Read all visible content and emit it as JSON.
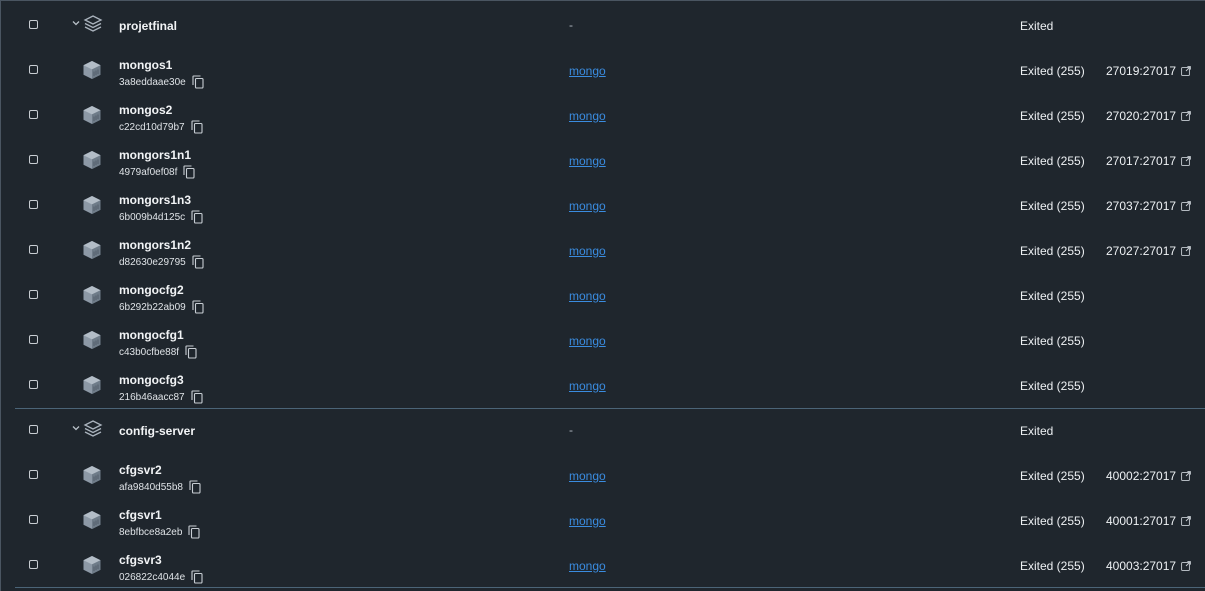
{
  "groups": [
    {
      "name": "projetfinal",
      "image": "-",
      "status": "Exited",
      "containers": [
        {
          "name": "mongos1",
          "id": "3a8eddaae30e",
          "image": "mongo",
          "status": "Exited (255)",
          "port": "27019:27017"
        },
        {
          "name": "mongos2",
          "id": "c22cd10d79b7",
          "image": "mongo",
          "status": "Exited (255)",
          "port": "27020:27017"
        },
        {
          "name": "mongors1n1",
          "id": "4979af0ef08f",
          "image": "mongo",
          "status": "Exited (255)",
          "port": "27017:27017"
        },
        {
          "name": "mongors1n3",
          "id": "6b009b4d125c",
          "image": "mongo",
          "status": "Exited (255)",
          "port": "27037:27017"
        },
        {
          "name": "mongors1n2",
          "id": "d82630e29795",
          "image": "mongo",
          "status": "Exited (255)",
          "port": "27027:27017"
        },
        {
          "name": "mongocfg2",
          "id": "6b292b22ab09",
          "image": "mongo",
          "status": "Exited (255)",
          "port": ""
        },
        {
          "name": "mongocfg1",
          "id": "c43b0cfbe88f",
          "image": "mongo",
          "status": "Exited (255)",
          "port": ""
        },
        {
          "name": "mongocfg3",
          "id": "216b46aacc87",
          "image": "mongo",
          "status": "Exited (255)",
          "port": ""
        }
      ]
    },
    {
      "name": "config-server",
      "image": "-",
      "status": "Exited",
      "containers": [
        {
          "name": "cfgsvr2",
          "id": "afa9840d55b8",
          "image": "mongo",
          "status": "Exited (255)",
          "port": "40002:27017"
        },
        {
          "name": "cfgsvr1",
          "id": "8ebfbce8a2eb",
          "image": "mongo",
          "status": "Exited (255)",
          "port": "40001:27017"
        },
        {
          "name": "cfgsvr3",
          "id": "026822c4044e",
          "image": "mongo",
          "status": "Exited (255)",
          "port": "40003:27017"
        }
      ]
    }
  ],
  "colors": {
    "background": "#1f262d",
    "link": "#3a8ce0",
    "divider": "#4b6477"
  },
  "icons": {
    "group": "stack-layers-icon",
    "container": "container-cube-icon",
    "copy": "copy-icon",
    "expand": "chevron-down-icon",
    "open_port": "external-link-icon"
  }
}
